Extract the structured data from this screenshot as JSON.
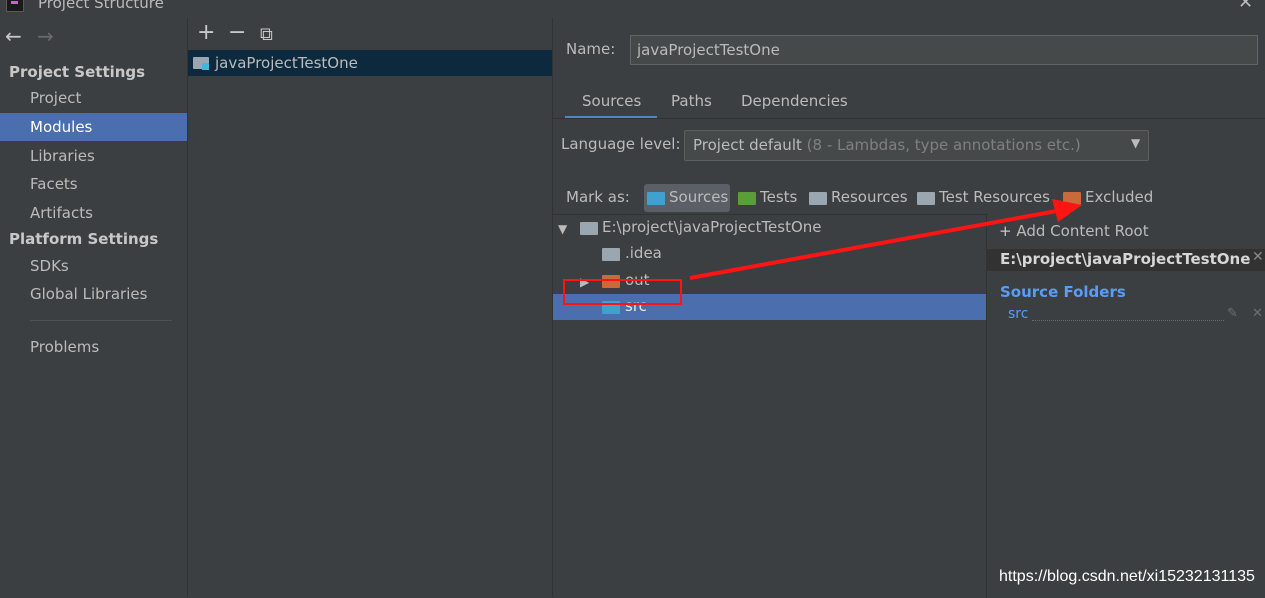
{
  "window": {
    "title": "Project Structure",
    "close_icon": "close-icon"
  },
  "colors": {
    "background": "#3c3f41",
    "selection": "#4b6eaf",
    "sources_folder": "#40a0d0",
    "tests_folder": "#5a9e3a",
    "excluded_folder": "#c86a3a",
    "plain_folder": "#9aa7b0",
    "annotation_red": "#ff1414",
    "link_blue": "#589df6"
  },
  "sidebar": {
    "project_settings_header": "Project Settings",
    "platform_settings_header": "Platform Settings",
    "items": [
      {
        "label": "Project"
      },
      {
        "label": "Modules",
        "selected": true
      },
      {
        "label": "Libraries"
      },
      {
        "label": "Facets"
      },
      {
        "label": "Artifacts"
      },
      {
        "label": "SDKs"
      },
      {
        "label": "Global Libraries"
      },
      {
        "label": "Problems"
      }
    ]
  },
  "modules": {
    "toolbar": {
      "add": "+",
      "remove": "−",
      "copy": "⧉"
    },
    "list": [
      {
        "label": "javaProjectTestOne",
        "selected": true
      }
    ]
  },
  "detail": {
    "name_label": "Name:",
    "name_value": "javaProjectTestOne",
    "tabs": [
      {
        "label": "Sources",
        "active": true
      },
      {
        "label": "Paths"
      },
      {
        "label": "Dependencies"
      }
    ],
    "language_level_label": "Language level:",
    "language_level_value": "Project default",
    "language_level_hint": "(8 - Lambdas, type annotations etc.)",
    "mark_as_label": "Mark as:",
    "mark_buttons": [
      {
        "label": "Sources",
        "icon": "sources-folder-icon",
        "active": true
      },
      {
        "label": "Tests",
        "icon": "tests-folder-icon"
      },
      {
        "label": "Resources",
        "icon": "resources-folder-icon"
      },
      {
        "label": "Test Resources",
        "icon": "test-resources-folder-icon"
      },
      {
        "label": "Excluded",
        "icon": "excluded-folder-icon"
      }
    ],
    "tree": {
      "root": "E:\\project\\javaProjectTestOne",
      "children": [
        {
          "label": ".idea",
          "type": "plain"
        },
        {
          "label": "out",
          "type": "excluded"
        },
        {
          "label": "src",
          "type": "sources",
          "selected": true
        }
      ]
    },
    "roots_panel": {
      "add_content_root": "Add Content Root",
      "root_path": "E:\\project\\javaProjectTestOne",
      "source_folders_header": "Source Folders",
      "source_folders": [
        "src"
      ]
    }
  },
  "watermark": "https://blog.csdn.net/xi15232131135"
}
